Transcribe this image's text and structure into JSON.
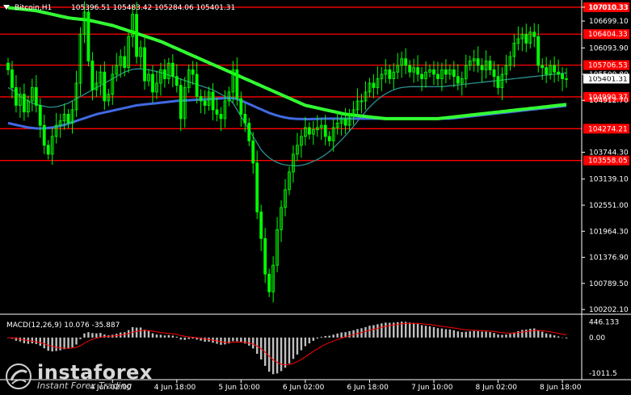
{
  "header": {
    "symbol": "Bitcoin,H1",
    "ohlc": "105396.51 105483.42 105284.06 105401.31",
    "macd_label": "MACD(12,26,9) 10.076 -35.887"
  },
  "price_axis": {
    "ticks": [
      "107010.33",
      "106699.10",
      "106093.90",
      "105500.80",
      "104912.70",
      "103744.30",
      "103139.10",
      "102551.00",
      "101964.30",
      "101376.90",
      "100789.50",
      "100202.10"
    ],
    "tick_values": [
      107010.33,
      106699.1,
      106093.9,
      105500.8,
      104912.7,
      103744.3,
      103139.1,
      102551.0,
      101964.3,
      101376.9,
      100789.5,
      100202.1
    ],
    "range": [
      100150,
      107100
    ]
  },
  "levels": [
    {
      "label": "107010.33",
      "value": 107010.33
    },
    {
      "label": "106404.33",
      "value": 106404.33
    },
    {
      "label": "105706.53",
      "value": 105706.53
    },
    {
      "label": "104990.37",
      "value": 104990.37
    },
    {
      "label": "104274.21",
      "value": 104274.21
    },
    {
      "label": "103558.05",
      "value": 103558.05
    }
  ],
  "current_price": {
    "label": "105401.31",
    "value": 105401.31
  },
  "macd_axis": {
    "ticks": [
      "446.133",
      "0.00",
      "-1011.5"
    ],
    "tick_values": [
      446.133,
      0,
      -1011.5
    ],
    "range": [
      -1100,
      500
    ]
  },
  "time_axis": {
    "labels": [
      "4 Jun 02:00",
      "4 Jun 18:00",
      "5 Jun 10:00",
      "6 Jun 02:00",
      "6 Jun 18:00",
      "7 Jun 10:00",
      "8 Jun 02:00",
      "8 Jun 18:00"
    ],
    "bar_index": [
      26,
      42,
      58,
      74,
      90,
      106,
      122,
      138
    ]
  },
  "colors": {
    "background": "#000000",
    "candles": "#00ff00",
    "level_line": "#ff0000",
    "ma_fast": "#2f8f8f",
    "ma_mid": "#4169e1",
    "ma_slow": "#33ff33",
    "macd_hist": "#c0c0c0",
    "macd_signal": "#ff0000",
    "axis_text": "#ffffff",
    "tag_bg": "#ff0000"
  },
  "logo": {
    "name": "instaforex",
    "tagline": "Instant Forex Trading"
  },
  "chart_data": {
    "type": "candlestick",
    "title": "Bitcoin,H1",
    "bar_count": 140,
    "closes": [
      105600,
      105200,
      104800,
      105050,
      104650,
      104900,
      105200,
      104800,
      104350,
      103900,
      103700,
      104100,
      104350,
      104450,
      104600,
      104400,
      104700,
      105300,
      106400,
      106900,
      105800,
      105150,
      105300,
      105550,
      104900,
      105050,
      105500,
      105700,
      105900,
      105650,
      106350,
      106850,
      105900,
      106100,
      105350,
      105500,
      105100,
      105300,
      105600,
      105400,
      105750,
      105450,
      105250,
      104500,
      105200,
      105600,
      105500,
      105000,
      104900,
      104800,
      105100,
      104700,
      104600,
      104500,
      104900,
      105100,
      105600,
      104950,
      104600,
      104400,
      104000,
      103500,
      102400,
      101800,
      101000,
      100600,
      101200,
      102000,
      102500,
      102900,
      103300,
      103700,
      103900,
      104100,
      104300,
      104150,
      104250,
      104300,
      104350,
      104100,
      104000,
      104300,
      104400,
      104500,
      104350,
      104600,
      104700,
      104900,
      104900,
      105100,
      105300,
      105200,
      105400,
      105500,
      105600,
      105400,
      105550,
      105700,
      105850,
      105700,
      105550,
      105650,
      105500,
      105400,
      105550,
      105600,
      105500,
      105400,
      105600,
      105500,
      105600,
      105450,
      105300,
      105400,
      105700,
      105800,
      105850,
      105700,
      105600,
      105800,
      105600,
      105450,
      105200,
      105500,
      105700,
      105900,
      106200,
      106300,
      106400,
      106200,
      106450,
      106350,
      105700,
      105650,
      105500,
      105700,
      105550,
      105500,
      105400,
      105401.31
    ],
    "ma_fast": [
      105200,
      105150,
      105100,
      105000,
      104950,
      104900,
      104850,
      104820,
      104800,
      104780,
      104760,
      104760,
      104770,
      104790,
      104820,
      104850,
      104900,
      104950,
      105000,
      105050,
      105100,
      105150,
      105200,
      105250,
      105300,
      105350,
      105400,
      105450,
      105500,
      105550,
      105580,
      105610,
      105620,
      105620,
      105610,
      105600,
      105580,
      105560,
      105540,
      105510,
      105480,
      105450,
      105420,
      105390,
      105360,
      105330,
      105300,
      105270,
      105240,
      105210,
      105180,
      105150,
      105100,
      105050,
      105000,
      104950,
      104850,
      104700,
      104550,
      104400,
      104250,
      104100,
      103950,
      103800,
      103700,
      103620,
      103560,
      103510,
      103480,
      103460,
      103450,
      103440,
      103440,
      103450,
      103470,
      103500,
      103540,
      103580,
      103630,
      103690,
      103760,
      103840,
      103930,
      104020,
      104120,
      104220,
      104330,
      104440,
      104550,
      104660,
      104760,
      104850,
      104930,
      105000,
      105060,
      105110,
      105150,
      105180,
      105200,
      105210,
      105220,
      105220,
      105220,
      105220,
      105220,
      105220,
      105220,
      105220,
      105220,
      105230,
      105240,
      105250,
      105260,
      105270,
      105280,
      105290,
      105300,
      105310,
      105320,
      105330,
      105340,
      105350,
      105360,
      105370,
      105380,
      105390,
      105400,
      105410,
      105420,
      105430,
      105440,
      105450,
      105460,
      105470,
      105480,
      105490,
      105500,
      105510,
      105520,
      105530
    ],
    "ma_mid": [
      104400,
      104380,
      104360,
      104340,
      104320,
      104300,
      104290,
      104280,
      104280,
      104280,
      104290,
      104300,
      104320,
      104340,
      104360,
      104390,
      104420,
      104450,
      104480,
      104510,
      104540,
      104570,
      104600,
      104620,
      104640,
      104660,
      104680,
      104700,
      104720,
      104740,
      104760,
      104780,
      104800,
      104810,
      104820,
      104830,
      104840,
      104850,
      104860,
      104870,
      104880,
      104890,
      104900,
      104905,
      104910,
      104915,
      104920,
      104925,
      104930,
      104935,
      104940,
      104945,
      104950,
      104955,
      104960,
      104965,
      104960,
      104940,
      104910,
      104870,
      104830,
      104790,
      104750,
      104710,
      104670,
      104630,
      104600,
      104570,
      104545,
      104525,
      104510,
      104500,
      104495,
      104492,
      104490,
      104490,
      104492,
      104495,
      104498,
      104500,
      104500,
      104500,
      104500,
      104500,
      104500,
      104500,
      104500,
      104500,
      104500,
      104500,
      104500,
      104500,
      104500,
      104500,
      104500,
      104500,
      104500,
      104500,
      104500,
      104500,
      104500,
      104500,
      104500,
      104500,
      104500,
      104500,
      104500,
      104500,
      104500,
      104500,
      104500,
      104510,
      104520,
      104530,
      104540,
      104550,
      104560,
      104570,
      104580,
      104590,
      104600,
      104610,
      104620,
      104630,
      104640,
      104650,
      104660,
      104670,
      104680,
      104690,
      104700,
      104710,
      104720,
      104730,
      104740,
      104750,
      104760,
      104770,
      104780,
      104790
    ],
    "ma_slow": [
      107000,
      106990,
      106980,
      106970,
      106960,
      106950,
      106940,
      106930,
      106910,
      106890,
      106870,
      106850,
      106830,
      106810,
      106790,
      106770,
      106760,
      106750,
      106740,
      106730,
      106720,
      106700,
      106680,
      106660,
      106640,
      106620,
      106600,
      106570,
      106540,
      106510,
      106480,
      106450,
      106420,
      106390,
      106360,
      106330,
      106300,
      106270,
      106240,
      106200,
      106160,
      106120,
      106080,
      106040,
      106000,
      105960,
      105920,
      105880,
      105840,
      105800,
      105760,
      105720,
      105680,
      105640,
      105600,
      105560,
      105520,
      105480,
      105440,
      105400,
      105360,
      105320,
      105280,
      105240,
      105200,
      105160,
      105120,
      105080,
      105040,
      105000,
      104960,
      104920,
      104880,
      104840,
      104800,
      104780,
      104760,
      104740,
      104720,
      104700,
      104680,
      104660,
      104640,
      104620,
      104600,
      104590,
      104580,
      104570,
      104560,
      104550,
      104540,
      104530,
      104520,
      104510,
      104500,
      104500,
      104500,
      104500,
      104500,
      104500,
      104500,
      104500,
      104500,
      104500,
      104500,
      104500,
      104500,
      104500,
      104510,
      104520,
      104530,
      104540,
      104550,
      104560,
      104570,
      104580,
      104590,
      104600,
      104610,
      104620,
      104630,
      104640,
      104650,
      104660,
      104670,
      104680,
      104690,
      104700,
      104710,
      104720,
      104730,
      104740,
      104750,
      104760,
      104770,
      104780,
      104790,
      104800,
      104810,
      104820
    ]
  }
}
